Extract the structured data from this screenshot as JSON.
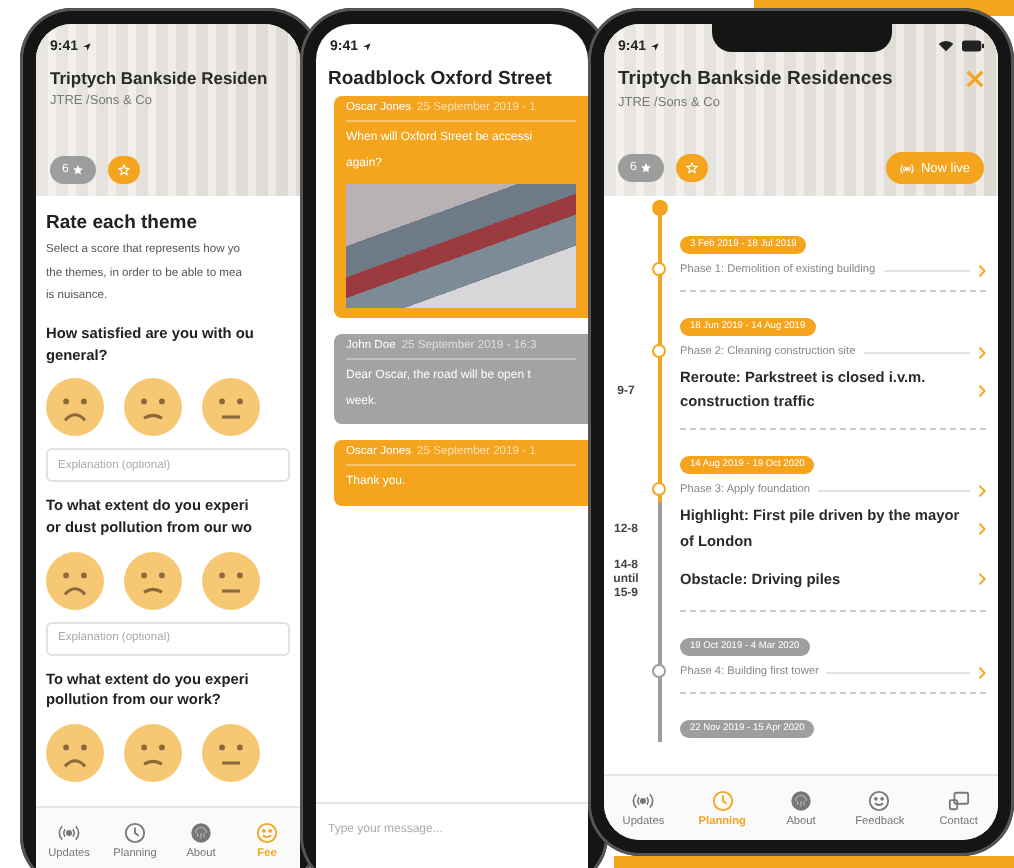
{
  "survey_screen": {
    "status_time": "9:41",
    "header": {
      "title": "Triptych Bankside Residen",
      "subtitle": "JTRE /Sons & Co",
      "rating": "6"
    },
    "heading": "Rate each theme",
    "intro": "Select a score that represents how yo\nthe themes, in order to be able to mea\nis nuisance.",
    "questions": [
      {
        "text": "How satisfied are you with ou\ngeneral?",
        "placeholder": "Explanation (optional)"
      },
      {
        "text": "To what extent do you experi\nor dust pollution from our wo",
        "placeholder": "Explanation (optional)"
      },
      {
        "text": "To what extent do you experi\npollution from our work?"
      }
    ],
    "tabs": [
      {
        "label": "Updates",
        "selected": false
      },
      {
        "label": "Planning",
        "selected": false
      },
      {
        "label": "About",
        "selected": false
      },
      {
        "label": "Fee",
        "selected": true
      }
    ]
  },
  "chat_screen": {
    "status_time": "9:41",
    "title": "Roadblock Oxford Street",
    "messages": [
      {
        "kind": "own",
        "author": "Oscar Jones",
        "time": "25 September 2019 - 1",
        "text": "When will Oxford Street be accessi\nagain?",
        "has_photo": true
      },
      {
        "kind": "other",
        "author": "John Doe",
        "time": "25 September 2019 - 16:3",
        "text": "Dear Oscar, the road will be open t\nweek.",
        "has_photo": false
      },
      {
        "kind": "own",
        "author": "Oscar Jones",
        "time": "25 September 2019 - 1",
        "text": "Thank you.",
        "has_photo": false
      }
    ],
    "input": {
      "placeholder": "Type your message..."
    }
  },
  "timeline_screen": {
    "status_time": "9:41",
    "header": {
      "title": "Triptych Bankside Residences",
      "subtitle": "JTRE /Sons & Co",
      "rating": "6",
      "live_label": "Now live"
    },
    "phases": [
      {
        "date": "3 Feb 2019 - 18 Jul 2019",
        "active": true,
        "title": "Phase 1: Demolition of existing building"
      },
      {
        "date": "18 Jun 2019 - 14 Aug 2019",
        "active": true,
        "title": "Phase 2: Cleaning construction site",
        "events": [
          {
            "date": "9-7",
            "text": "Reroute: Parkstreet is closed i.v.m. construction traffic"
          }
        ]
      },
      {
        "date": "14 Aug 2019 - 19 Oct 2020",
        "active": true,
        "title": "Phase 3: Apply foundation",
        "events": [
          {
            "date": "12-8",
            "text": "Highlight: First pile driven by the mayor of London"
          },
          {
            "date": "14-8\nuntil\n15-9",
            "text": "Obstacle: Driving piles"
          }
        ]
      },
      {
        "date": "19 Oct 2019 - 4 Mar 2020",
        "active": false,
        "title": "Phase 4: Building first tower"
      },
      {
        "date": "22 Nov 2019 - 15 Apr 2020",
        "active": false
      }
    ],
    "tabs": [
      {
        "label": "Updates",
        "selected": false
      },
      {
        "label": "Planning",
        "selected": true
      },
      {
        "label": "About",
        "selected": false
      },
      {
        "label": "Feedback",
        "selected": false
      },
      {
        "label": "Contact",
        "selected": false
      }
    ]
  }
}
